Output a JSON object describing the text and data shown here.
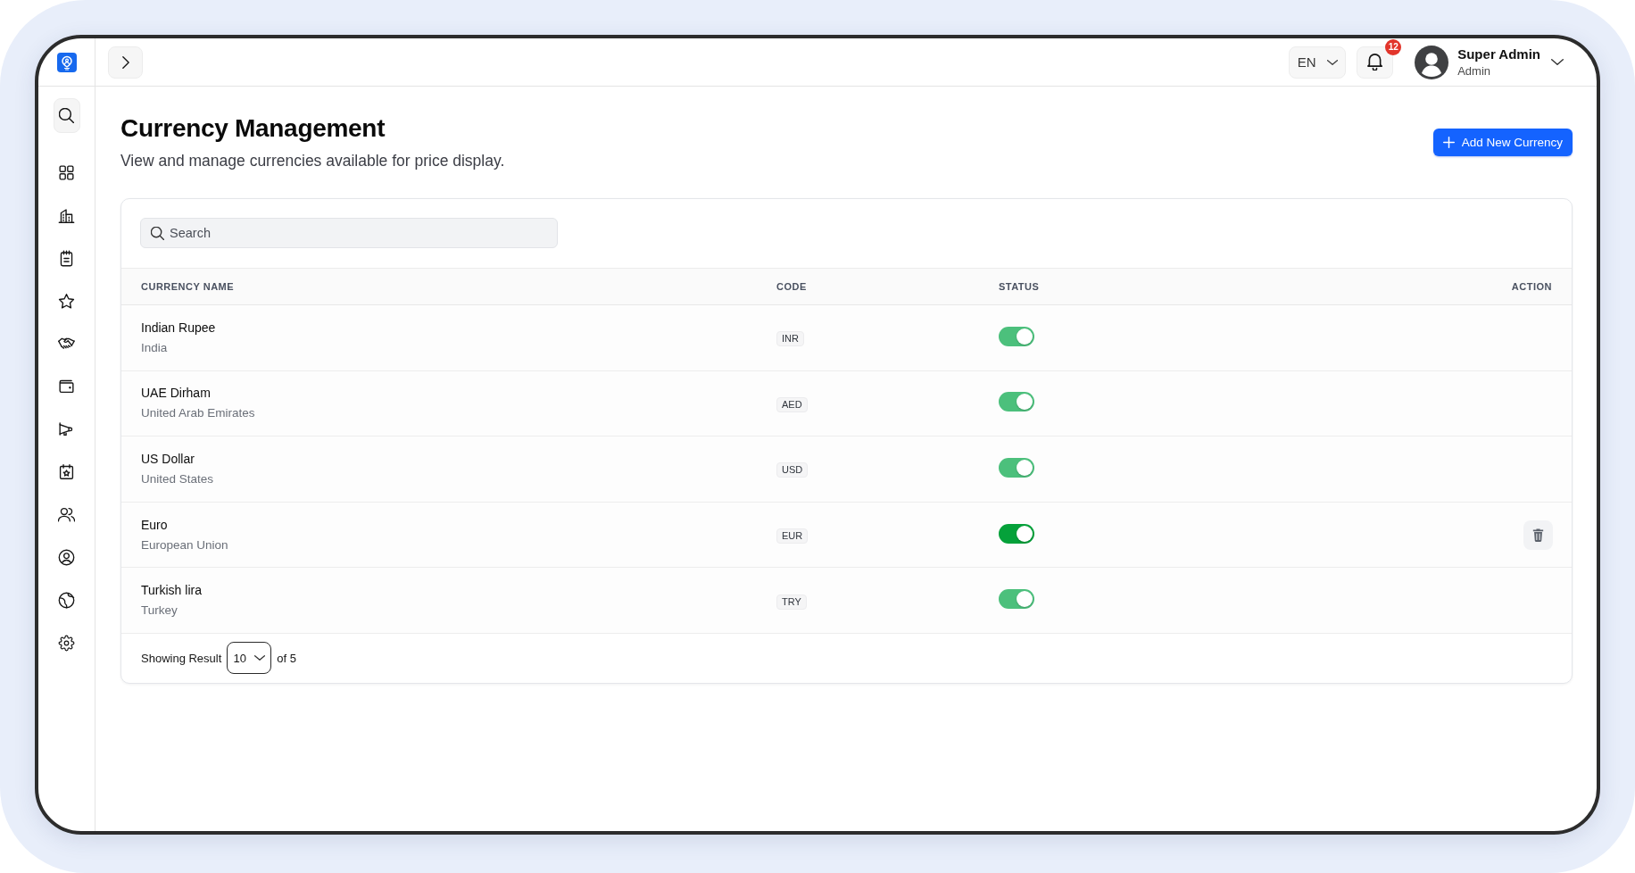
{
  "topbar": {
    "language": "EN",
    "notification_count": "12",
    "user": {
      "name": "Super Admin",
      "role": "Admin"
    }
  },
  "page": {
    "title": "Currency Management",
    "subtitle": "View and manage currencies available for price display.",
    "add_button": "Add New Currency"
  },
  "search": {
    "placeholder": "Search"
  },
  "table": {
    "columns": [
      "CURRENCY NAME",
      "CODE",
      "STATUS",
      "ACTION"
    ],
    "rows": [
      {
        "name": "Indian Rupee",
        "country": "India",
        "code": "INR",
        "active": true,
        "hovered": false
      },
      {
        "name": "UAE Dirham",
        "country": "United Arab Emirates",
        "code": "AED",
        "active": true,
        "hovered": false
      },
      {
        "name": "US Dollar",
        "country": "United States",
        "code": "USD",
        "active": true,
        "hovered": false
      },
      {
        "name": "Euro",
        "country": "European Union",
        "code": "EUR",
        "active": true,
        "hovered": true
      },
      {
        "name": "Turkish lira",
        "country": "Turkey",
        "code": "TRY",
        "active": true,
        "hovered": false
      }
    ]
  },
  "pagination": {
    "label": "Showing Result",
    "page_size": "10",
    "total": "of 5"
  }
}
